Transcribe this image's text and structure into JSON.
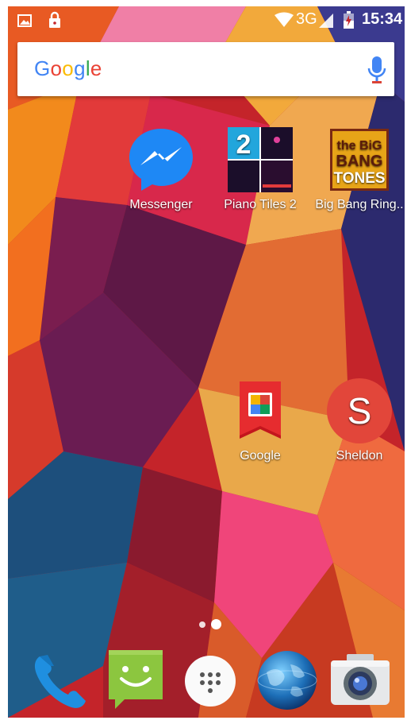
{
  "status_bar": {
    "network": "3G",
    "time": "15:34",
    "icons": [
      "image-notification-icon",
      "lock-notification-icon",
      "wifi-icon",
      "signal-icon",
      "battery-icon"
    ]
  },
  "search_bar": {
    "logo_text": "Google",
    "logo_colors": [
      "#4285F4",
      "#EA4335",
      "#FBBC05",
      "#4285F4",
      "#34A853",
      "#EA4335"
    ],
    "mic_icon": "mic-icon"
  },
  "home_apps": [
    {
      "label": "Messenger",
      "icon": "messenger-icon"
    },
    {
      "label": "Piano Tiles 2",
      "icon": "piano-tiles-icon",
      "icon_text": "2"
    },
    {
      "label": "Big Bang Ring..",
      "icon": "big-bang-tones-icon",
      "icon_text": [
        "the BiG",
        "BANG",
        "TONES"
      ]
    },
    {
      "label": "Google",
      "icon": "google-folder-icon"
    },
    {
      "label": "Sheldon",
      "icon": "contact-avatar-icon",
      "icon_text": "S"
    }
  ],
  "page_indicator": {
    "pages": 2,
    "current": 2
  },
  "dock": [
    {
      "name": "phone",
      "icon": "phone-icon"
    },
    {
      "name": "messaging",
      "icon": "messaging-icon"
    },
    {
      "name": "app-drawer",
      "icon": "app-drawer-icon"
    },
    {
      "name": "browser",
      "icon": "globe-icon"
    },
    {
      "name": "camera",
      "icon": "camera-icon"
    }
  ],
  "colors": {
    "wallpaper_base": "#c4242a",
    "avatar_red": "#e2463a",
    "messenger_blue": "#1e88f5"
  }
}
